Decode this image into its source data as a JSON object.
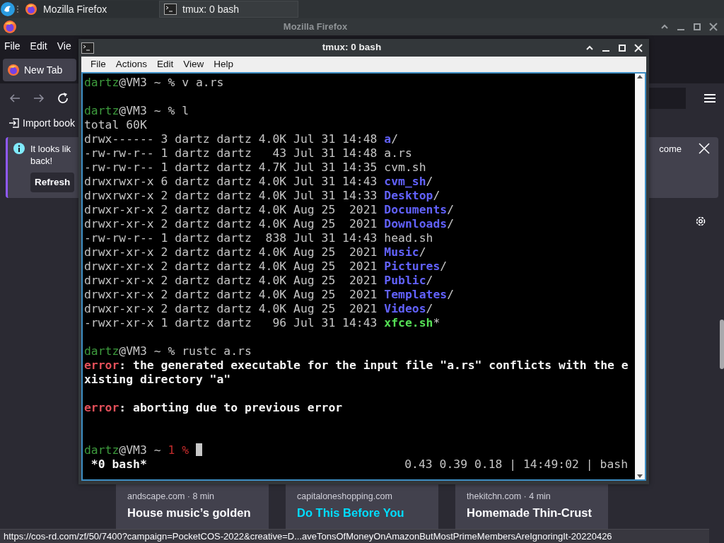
{
  "taskbar": {
    "tasks": [
      {
        "kind": "firefox",
        "label": "Mozilla Firefox",
        "selected": false
      },
      {
        "kind": "terminal",
        "label": "tmux: 0 bash",
        "selected": true
      }
    ]
  },
  "firefox": {
    "title": "Mozilla Firefox",
    "menu": [
      "File",
      "Edit",
      "Vie"
    ],
    "tab": "New Tab",
    "bookmark": "Import book",
    "notification": {
      "lines": [
        "It looks lik",
        "back!"
      ],
      "tail": "come",
      "button": "Refresh"
    },
    "stories": [
      {
        "kind": "article",
        "source": "andscape.com · 8 min",
        "title": "House music’s golden"
      },
      {
        "kind": "sponsored",
        "source": "capitaloneshopping.com",
        "title": "Do This Before You"
      },
      {
        "kind": "article",
        "source": "thekitchn.com · 4 min",
        "title": "Homemade Thin-Crust"
      }
    ],
    "status_url": "https://cos-rd.com/zf/50/7400?campaign=PocketCOS-2022&creative=D...aveTonsOfMoneyOnAmazonButMostPrimeMembersAreIgnoringIt-20220426"
  },
  "terminal": {
    "title": "tmux: 0 bash",
    "menu": [
      "File",
      "Actions",
      "Edit",
      "View",
      "Help"
    ],
    "lines": [
      {
        "kind": "output",
        "segments": [
          {
            "kind": "user",
            "text": "dartz"
          },
          {
            "kind": "host",
            "text": "@VM3 ~ % v a.rs"
          }
        ]
      },
      {
        "kind": "blank"
      },
      {
        "kind": "output",
        "segments": [
          {
            "kind": "user",
            "text": "dartz"
          },
          {
            "kind": "host",
            "text": "@VM3 ~ % l"
          }
        ]
      },
      {
        "kind": "output",
        "segments": [
          {
            "kind": "text",
            "text": "total 60K"
          }
        ]
      },
      {
        "kind": "output",
        "segments": [
          {
            "kind": "text",
            "text": "drwx------ 3 dartz dartz 4.0K Jul 31 14:48 "
          },
          {
            "kind": "dir",
            "text": "a"
          },
          {
            "kind": "text",
            "text": "/"
          }
        ]
      },
      {
        "kind": "output",
        "segments": [
          {
            "kind": "text",
            "text": "-rw-rw-r-- 1 dartz dartz   43 Jul 31 14:48 a.rs"
          }
        ]
      },
      {
        "kind": "output",
        "segments": [
          {
            "kind": "text",
            "text": "-rw-rw-r-- 1 dartz dartz 4.7K Jul 31 14:35 cvm.sh"
          }
        ]
      },
      {
        "kind": "output",
        "segments": [
          {
            "kind": "text",
            "text": "drwxrwxr-x 6 dartz dartz 4.0K Jul 31 14:43 "
          },
          {
            "kind": "dir",
            "text": "cvm_sh"
          },
          {
            "kind": "text",
            "text": "/"
          }
        ]
      },
      {
        "kind": "output",
        "segments": [
          {
            "kind": "text",
            "text": "drwxrwxr-x 2 dartz dartz 4.0K Jul 31 14:33 "
          },
          {
            "kind": "dir",
            "text": "Desktop"
          },
          {
            "kind": "text",
            "text": "/"
          }
        ]
      },
      {
        "kind": "output",
        "segments": [
          {
            "kind": "text",
            "text": "drwxr-xr-x 2 dartz dartz 4.0K Aug 25  2021 "
          },
          {
            "kind": "dir",
            "text": "Documents"
          },
          {
            "kind": "text",
            "text": "/"
          }
        ]
      },
      {
        "kind": "output",
        "segments": [
          {
            "kind": "text",
            "text": "drwxr-xr-x 2 dartz dartz 4.0K Aug 25  2021 "
          },
          {
            "kind": "dir",
            "text": "Downloads"
          },
          {
            "kind": "text",
            "text": "/"
          }
        ]
      },
      {
        "kind": "output",
        "segments": [
          {
            "kind": "text",
            "text": "-rw-rw-r-- 1 dartz dartz  838 Jul 31 14:43 head.sh"
          }
        ]
      },
      {
        "kind": "output",
        "segments": [
          {
            "kind": "text",
            "text": "drwxr-xr-x 2 dartz dartz 4.0K Aug 25  2021 "
          },
          {
            "kind": "dir",
            "text": "Music"
          },
          {
            "kind": "text",
            "text": "/"
          }
        ]
      },
      {
        "kind": "output",
        "segments": [
          {
            "kind": "text",
            "text": "drwxr-xr-x 2 dartz dartz 4.0K Aug 25  2021 "
          },
          {
            "kind": "dir",
            "text": "Pictures"
          },
          {
            "kind": "text",
            "text": "/"
          }
        ]
      },
      {
        "kind": "output",
        "segments": [
          {
            "kind": "text",
            "text": "drwxr-xr-x 2 dartz dartz 4.0K Aug 25  2021 "
          },
          {
            "kind": "dir",
            "text": "Public"
          },
          {
            "kind": "text",
            "text": "/"
          }
        ]
      },
      {
        "kind": "output",
        "segments": [
          {
            "kind": "text",
            "text": "drwxr-xr-x 2 dartz dartz 4.0K Aug 25  2021 "
          },
          {
            "kind": "dir",
            "text": "Templates"
          },
          {
            "kind": "text",
            "text": "/"
          }
        ]
      },
      {
        "kind": "output",
        "segments": [
          {
            "kind": "text",
            "text": "drwxr-xr-x 2 dartz dartz 4.0K Aug 25  2021 "
          },
          {
            "kind": "dir",
            "text": "Videos"
          },
          {
            "kind": "text",
            "text": "/"
          }
        ]
      },
      {
        "kind": "output",
        "segments": [
          {
            "kind": "text",
            "text": "-rwxr-xr-x 1 dartz dartz   96 Jul 31 14:43 "
          },
          {
            "kind": "exec",
            "text": "xfce.sh"
          },
          {
            "kind": "text",
            "text": "*"
          }
        ]
      },
      {
        "kind": "blank"
      },
      {
        "kind": "output",
        "segments": [
          {
            "kind": "user",
            "text": "dartz"
          },
          {
            "kind": "host",
            "text": "@VM3 ~ % rustc a.rs"
          }
        ]
      },
      {
        "kind": "output",
        "segments": [
          {
            "kind": "error",
            "text": "error"
          },
          {
            "kind": "bold",
            "text": ": the generated executable for the input file \"a.rs\" conflicts with the e"
          }
        ]
      },
      {
        "kind": "output",
        "segments": [
          {
            "kind": "bold",
            "text": "xisting directory \"a\""
          }
        ]
      },
      {
        "kind": "blank"
      },
      {
        "kind": "output",
        "segments": [
          {
            "kind": "error",
            "text": "error"
          },
          {
            "kind": "bold",
            "text": ": aborting due to previous error"
          }
        ]
      },
      {
        "kind": "blank"
      },
      {
        "kind": "blank"
      },
      {
        "kind": "output",
        "segments": [
          {
            "kind": "user",
            "text": "dartz"
          },
          {
            "kind": "host",
            "text": "@VM3 ~ "
          },
          {
            "kind": "code",
            "text": "1 %"
          }
        ],
        "cursor": true
      }
    ],
    "status": {
      "left": " *0 bash*",
      "right": "0.43 0.39 0.18 | 14:49:02 | bash"
    }
  }
}
